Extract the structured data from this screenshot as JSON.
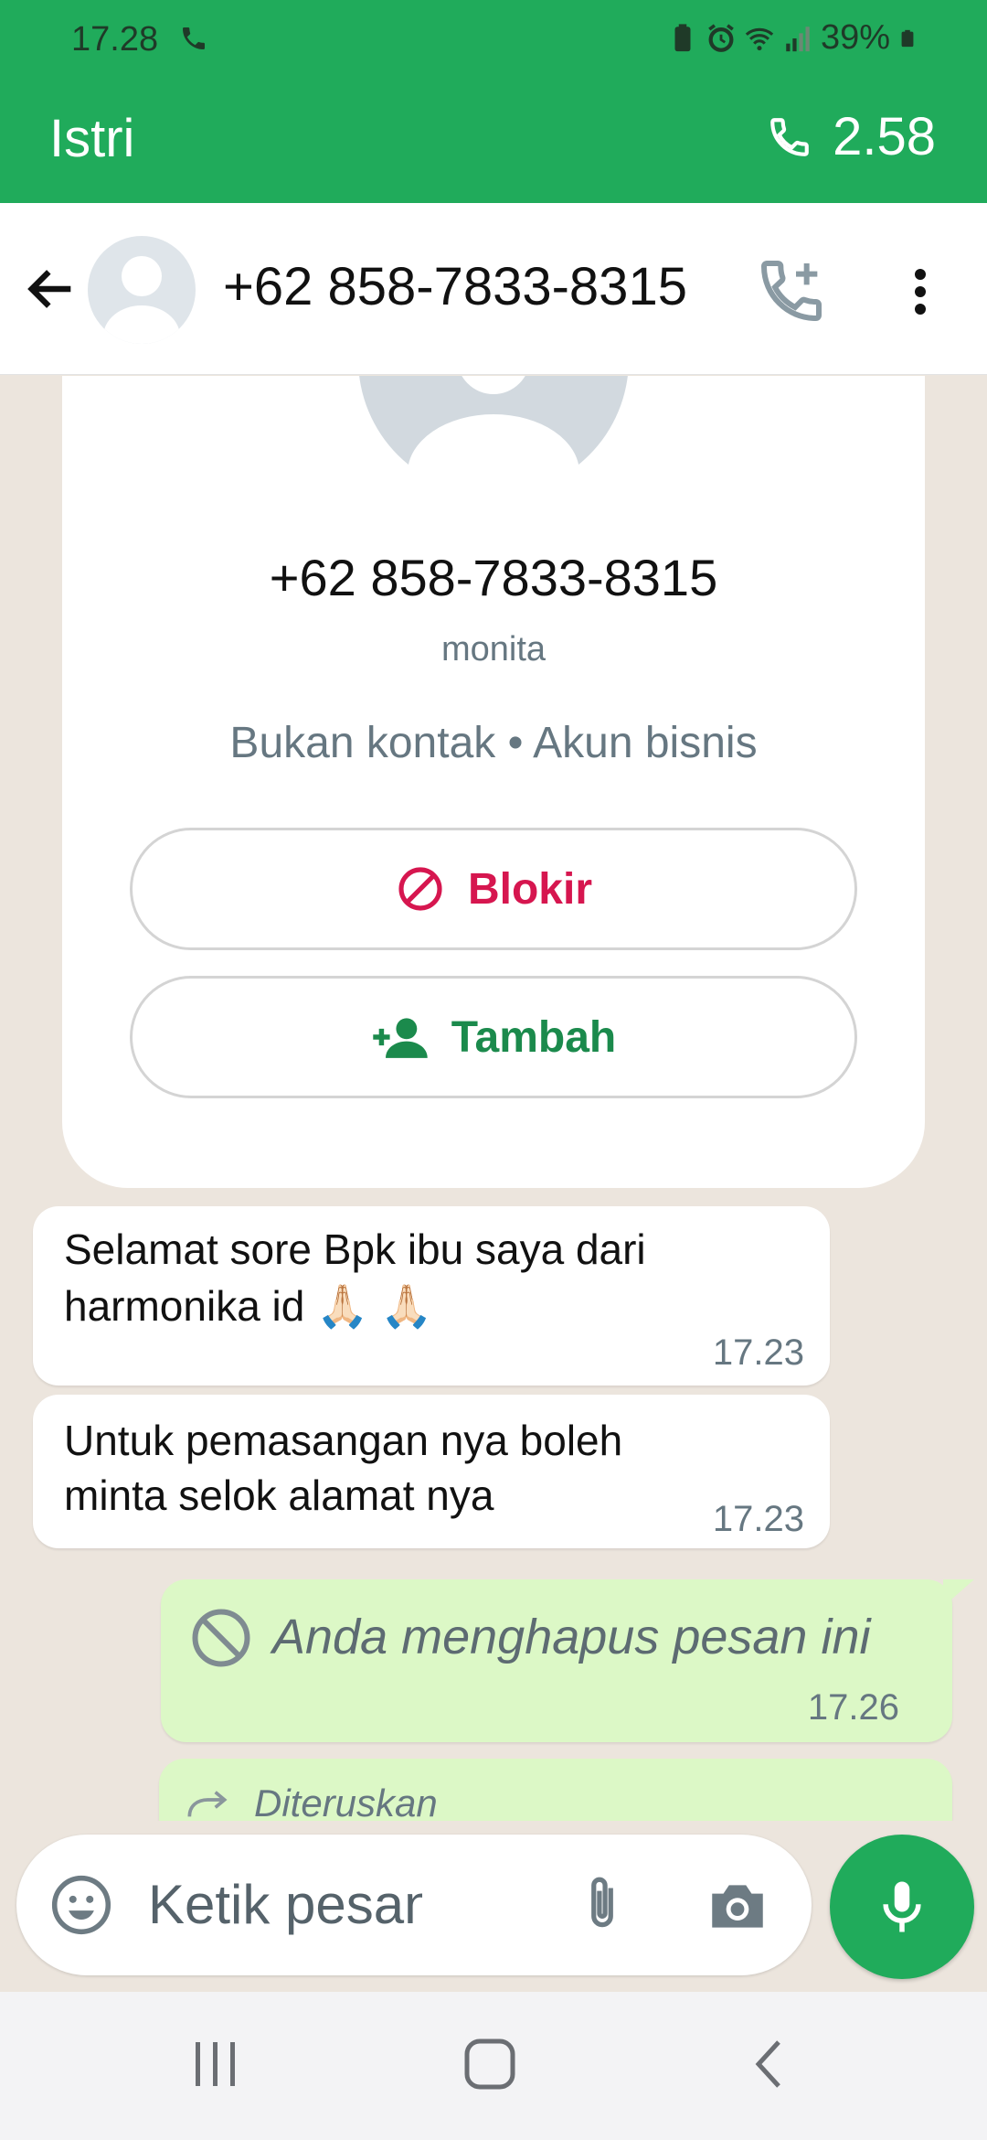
{
  "status_bar": {
    "time": "17.28",
    "battery": "39%"
  },
  "call_banner": {
    "name": "Istri",
    "duration": "2.58"
  },
  "header": {
    "title": "+62 858-7833-8315"
  },
  "profile": {
    "number": "+62 858-7833-8315",
    "push_name": "monita",
    "status": "Bukan kontak • Akun bisnis",
    "block_label": "Blokir",
    "add_label": "Tambah"
  },
  "messages": [
    {
      "text": "Selamat sore Bpk ibu saya dari harmonika id 🙏🏻 🙏🏻",
      "time": "17.23"
    },
    {
      "text": "Untuk pemasangan nya boleh minta selok alamat nya",
      "time": "17.23"
    },
    {
      "text": "Anda menghapus pesan ini",
      "time": "17.26"
    },
    {
      "text": "Diteruskan"
    }
  ],
  "composer": {
    "placeholder": "Ketik pesan"
  },
  "colors": {
    "brand_green": "#20ab5b",
    "block_red": "#d6164f",
    "add_green": "#1b8a4c",
    "outgoing_bubble": "#dcf8c6"
  }
}
